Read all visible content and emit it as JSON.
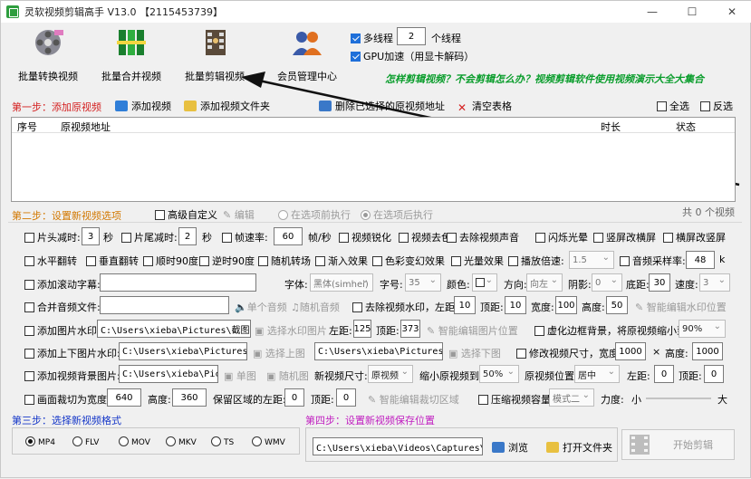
{
  "window": {
    "title": "灵软视频剪辑高手 V13.0 【2115453739】",
    "controls": [
      "—",
      "☐",
      "✕"
    ]
  },
  "toolbar": {
    "buttons": [
      {
        "label": "批量转换视频",
        "icon": "film-reel-icon"
      },
      {
        "label": "批量合并视频",
        "icon": "merge-blocks-icon"
      },
      {
        "label": "批量剪辑视频",
        "icon": "clapper-icon"
      },
      {
        "label": "会员管理中心",
        "icon": "members-icon"
      }
    ],
    "multithread_label": "多线程",
    "multithread_value": "2",
    "thread_unit": "个线程",
    "gpu_label": "GPU加速（用显卡解码）",
    "promo": "怎样剪辑视频？不会剪辑怎么办？视频剪辑软件使用视频演示大全大集合"
  },
  "step1": {
    "title": "第一步：添加原视频",
    "add_video": "添加视频",
    "add_folder": "添加视频文件夹",
    "delete_added": "删除已选择的原视频地址",
    "clear": "清空表格",
    "select_all": "全选",
    "invert": "反选",
    "columns": [
      "序号",
      "原视频地址",
      "时长",
      "状态"
    ],
    "count": "共 0 个视频"
  },
  "step2": {
    "title": "第二步：设置新视频选项",
    "advanced": "高级自定义",
    "edit": "编辑",
    "before_exec": "在选项前执行",
    "after_exec": "在选项后执行",
    "row1": {
      "head_cut": "片头减时:",
      "head_val": "3",
      "sec": "秒",
      "tail_cut": "片尾减时:",
      "tail_val": "2",
      "fps": "帧速率:",
      "fps_val": "60",
      "fps_unit": "帧/秒",
      "sharpen": "视频锐化",
      "decolor": "视频去色",
      "remove_audio": "去除视频声音",
      "flash": "闪烁光晕",
      "v2h": "竖屏改横屏",
      "h2v": "横屏改竖屏"
    },
    "row2": {
      "hflip": "水平翻转",
      "vflip": "垂直翻转",
      "cw90": "顺时90度",
      "ccw90": "逆时90度",
      "random_trans": "随机转场",
      "fade_in": "渐入效果",
      "color_fx": "色彩变幻效果",
      "light_fx": "光量效果",
      "speed": "播放倍速:",
      "speed_val": "1.5",
      "sample_rate": "音频采样率:",
      "sample_val": "48",
      "sample_unit": "k"
    },
    "row3": {
      "scroll_sub": "添加滚动字幕:",
      "font": "字体:",
      "font_val": "黑体(simhei)",
      "size": "字号:",
      "size_val": "35",
      "color": "颜色:",
      "direction": "方向:",
      "direction_val": "向左",
      "shadow": "阴影:",
      "shadow_val": "0",
      "bottom": "底距:",
      "bottom_val": "30",
      "speed": "速度:",
      "speed_val": "3"
    },
    "row4": {
      "merge_audio": "合并音频文件:",
      "single_audio": "单个音频",
      "random_audio": "随机音频",
      "remove_wm": "去除视频水印，左距:",
      "left_val": "10",
      "top": "顶距:",
      "top_val": "10",
      "width": "宽度:",
      "width_val": "100",
      "height": "高度:",
      "height_val": "50",
      "smart_wm": "智能编辑水印位置"
    },
    "row5": {
      "img_wm": "添加图片水印:",
      "img_path": "C:\\Users\\xieba\\Pictures\\截图\\Ymhc",
      "choose_img": "选择水印图片",
      "left": "左距:",
      "left_val": "125",
      "top": "顶距:",
      "top_val": "373",
      "smart_img": "智能编辑图片位置",
      "blur_bg": "虚化边框背景，将原视频缩小到:",
      "blur_val": "90%"
    },
    "row6": {
      "tb_wm": "添加上下图片水印:",
      "top_path": "C:\\Users\\xieba\\Pictures\\Scree",
      "choose_top": "选择上图",
      "bottom_path": "C:\\Users\\xieba\\Pictures\\Scree",
      "choose_bottom": "选择下图",
      "resize": "修改视频尺寸，宽度:",
      "w_val": "1000",
      "times": "×",
      "h_label": "高度:",
      "h_val": "1000"
    },
    "row7": {
      "bg_img": "添加视频背景图片:",
      "bg_path": "C:\\Users\\xieba\\Pictures",
      "single_img": "单图",
      "random_img": "随机图",
      "new_size": "新视频尺寸:",
      "new_size_val": "原视频",
      "shrink": "缩小原视频到:",
      "shrink_val": "50%",
      "position": "原视频位置:",
      "position_val": "居中",
      "left": "左距:",
      "left_val": "0",
      "top": "顶距:",
      "top_val": "0"
    },
    "row8": {
      "crop": "画面裁切为宽度:",
      "crop_w": "640",
      "height": "高度:",
      "crop_h": "360",
      "keep_left": "保留区域的左距:",
      "keep_left_val": "0",
      "top": "顶距:",
      "top_val": "0",
      "smart_crop": "智能编辑裁切区域",
      "compress": "压缩视频容量",
      "mode_val": "模式二",
      "strength": "力度:",
      "small": "小",
      "large": "大"
    }
  },
  "step3": {
    "title": "第三步：选择新视频格式",
    "formats": [
      "MP4",
      "FLV",
      "MOV",
      "MKV",
      "TS",
      "WMV"
    ],
    "selected": "MP4"
  },
  "step4": {
    "title": "第四步：设置新视频保存位置",
    "path": "C:\\Users\\xieba\\Videos\\Captures\\新建文件",
    "browse": "浏览",
    "open_folder": "打开文件夹",
    "start": "开始剪辑"
  },
  "colors": {
    "step_title_red": "#d42020",
    "step_title_orange": "#d27800",
    "step_title_blue": "#1436c8",
    "step_title_magenta": "#c020c0",
    "promo_green": "#0a9d2c",
    "checkbox_blue": "#1e6fd9"
  }
}
